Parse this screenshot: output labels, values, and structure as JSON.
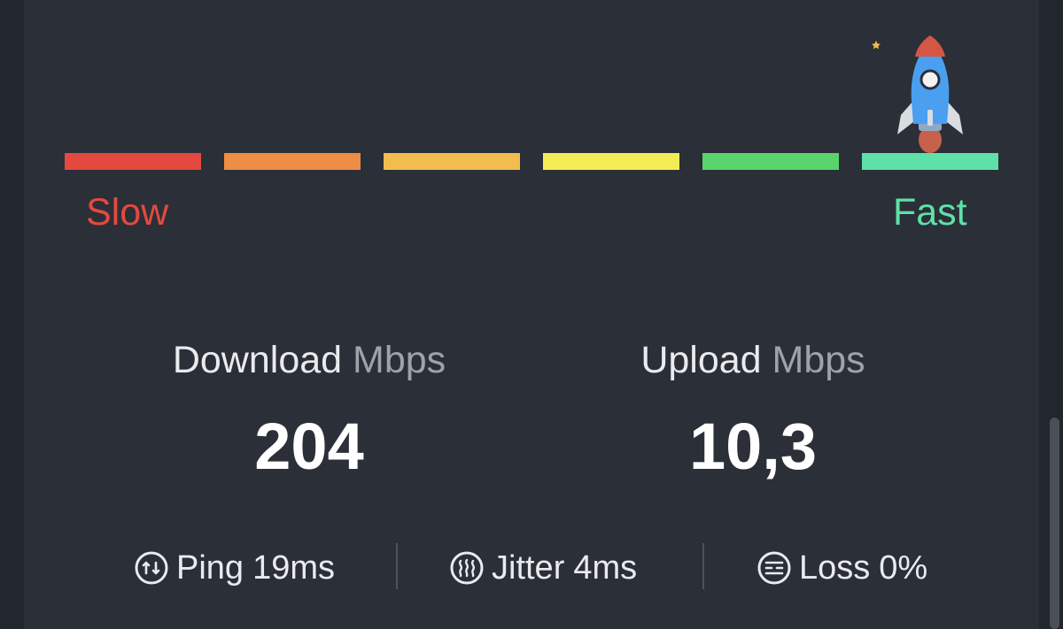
{
  "speed_scale": {
    "segments": [
      {
        "name": "seg-1",
        "color": "#e4493f"
      },
      {
        "name": "seg-2",
        "color": "#ee8d45"
      },
      {
        "name": "seg-3",
        "color": "#f2bd4e"
      },
      {
        "name": "seg-4",
        "color": "#f4ec55"
      },
      {
        "name": "seg-5",
        "color": "#5ad46d"
      },
      {
        "name": "seg-6",
        "color": "#5fe0a8"
      }
    ],
    "slow_label": "Slow",
    "fast_label": "Fast",
    "slow_color": "#e4493f",
    "fast_color": "#5fe0a8",
    "rocket_icon": "rocket-icon"
  },
  "download": {
    "label": "Download",
    "unit": "Mbps",
    "value": "204"
  },
  "upload": {
    "label": "Upload",
    "unit": "Mbps",
    "value": "10,3"
  },
  "stats": {
    "ping": {
      "icon": "ping-icon",
      "label": "Ping",
      "value": "19ms"
    },
    "jitter": {
      "icon": "jitter-icon",
      "label": "Jitter",
      "value": "4ms"
    },
    "loss": {
      "icon": "loss-icon",
      "label": "Loss",
      "value": "0%"
    }
  }
}
